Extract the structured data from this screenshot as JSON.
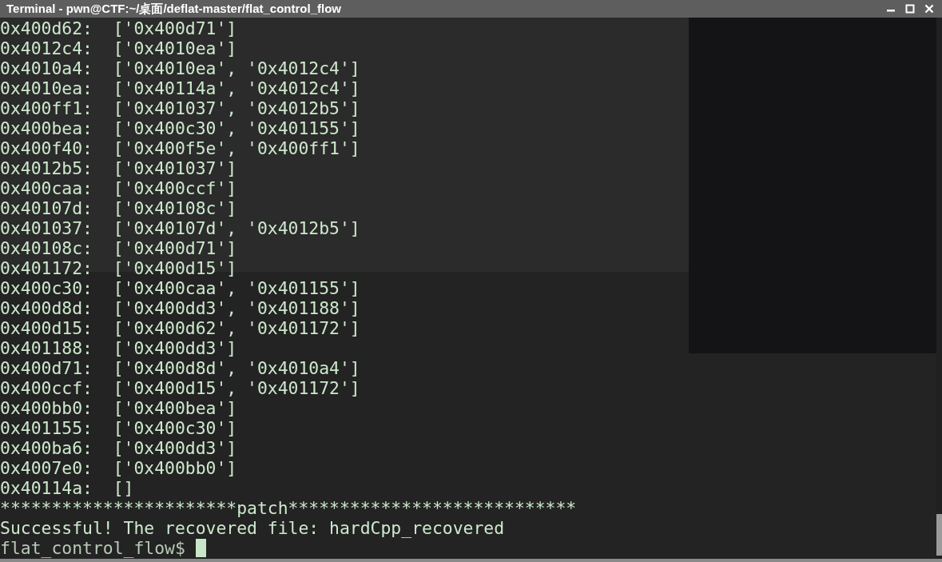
{
  "window": {
    "title": "Terminal - pwn@CTF:~/桌面/deflat-master/flat_control_flow"
  },
  "output_lines": [
    "0x400d62:  ['0x400d71']",
    "0x4012c4:  ['0x4010ea']",
    "0x4010a4:  ['0x4010ea', '0x4012c4']",
    "0x4010ea:  ['0x40114a', '0x4012c4']",
    "0x400ff1:  ['0x401037', '0x4012b5']",
    "0x400bea:  ['0x400c30', '0x401155']",
    "0x400f40:  ['0x400f5e', '0x400ff1']",
    "0x4012b5:  ['0x401037']",
    "0x400caa:  ['0x400ccf']",
    "0x40107d:  ['0x40108c']",
    "0x401037:  ['0x40107d', '0x4012b5']",
    "0x40108c:  ['0x400d71']",
    "0x401172:  ['0x400d15']",
    "0x400c30:  ['0x400caa', '0x401155']",
    "0x400d8d:  ['0x400dd3', '0x401188']",
    "0x400d15:  ['0x400d62', '0x401172']",
    "0x401188:  ['0x400dd3']",
    "0x400d71:  ['0x400d8d', '0x4010a4']",
    "0x400ccf:  ['0x400d15', '0x401172']",
    "0x400bb0:  ['0x400bea']",
    "0x401155:  ['0x400c30']",
    "0x400ba6:  ['0x400dd3']",
    "0x4007e0:  ['0x400bb0']",
    "0x40114a:  []",
    "***********************patch****************************",
    "Successful! The recovered file: hardCpp_recovered"
  ],
  "prompt": {
    "text": "flat_control_flow$"
  }
}
